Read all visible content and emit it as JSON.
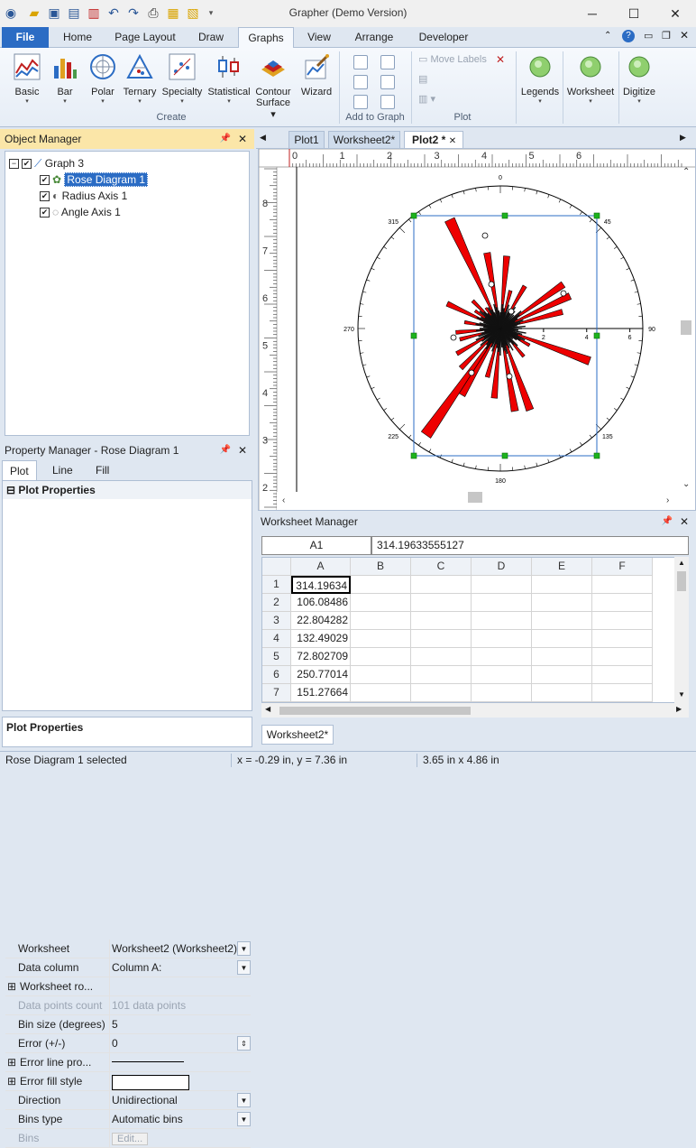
{
  "window": {
    "title": "Grapher (Demo Version)"
  },
  "ribbon_tabs": [
    "File",
    "Home",
    "Page Layout",
    "Draw",
    "Graphs",
    "View",
    "Arrange",
    "Developer"
  ],
  "ribbon": {
    "create": [
      "Basic",
      "Bar",
      "Polar",
      "Ternary",
      "Specialty",
      "Statistical"
    ],
    "contour_1": "Contour",
    "contour_2": "Surface",
    "wizard": "Wizard",
    "move_labels": "Move Labels",
    "legends": "Legends",
    "worksheet": "Worksheet",
    "digitize": "Digitize",
    "groups": {
      "create": "Create",
      "add": "Add to Graph",
      "plot": "Plot"
    }
  },
  "object_manager": {
    "title": "Object Manager",
    "graph": "Graph 3",
    "items": [
      "Rose Diagram 1",
      "Radius Axis 1",
      "Angle Axis 1"
    ]
  },
  "property_manager": {
    "title": "Property Manager - Rose Diagram 1",
    "tabs": [
      "Plot",
      "Line",
      "Fill"
    ],
    "section": "Plot Properties",
    "rows": [
      {
        "k": "Worksheet",
        "v": "Worksheet2 (Worksheet2)"
      },
      {
        "k": "Data column",
        "v": "Column A:"
      },
      {
        "k": "Worksheet ro...",
        "v": ""
      },
      {
        "k": "Data points count",
        "v": "101 data points"
      },
      {
        "k": "Bin size (degrees)",
        "v": "5"
      },
      {
        "k": "Error (+/-)",
        "v": "0"
      },
      {
        "k": "Error line pro...",
        "v": ""
      },
      {
        "k": "Error fill style",
        "v": ""
      },
      {
        "k": "Direction",
        "v": "Unidirectional"
      },
      {
        "k": "Bins type",
        "v": "Automatic bins"
      },
      {
        "k": "Bins",
        "v": "Edit..."
      }
    ],
    "help_title": "Plot Properties"
  },
  "doc_tabs": [
    "Plot1",
    "Worksheet2*",
    "Plot2 *"
  ],
  "plot": {
    "ruler_h": [
      "0",
      "1",
      "2",
      "3",
      "4",
      "5",
      "6"
    ],
    "ruler_v": [
      "8",
      "7",
      "6",
      "5",
      "4",
      "3",
      "2"
    ],
    "angle_labels": {
      "a0": "0",
      "a45": "45",
      "a90": "90",
      "a135": "135",
      "a180": "180",
      "a225": "225",
      "a270": "270",
      "a315": "315"
    },
    "axis_ticks": [
      "2",
      "4",
      "6"
    ]
  },
  "worksheet_manager": {
    "title": "Worksheet Manager",
    "cell_ref": "A1",
    "cell_value": "314.19633555127",
    "columns": [
      "A",
      "B",
      "C",
      "D",
      "E",
      "F"
    ],
    "rows": [
      [
        "1",
        "314.19634"
      ],
      [
        "2",
        "106.08486"
      ],
      [
        "3",
        "22.804282"
      ],
      [
        "4",
        "132.49029"
      ],
      [
        "5",
        "72.802709"
      ],
      [
        "6",
        "250.77014"
      ],
      [
        "7",
        "151.27664"
      ]
    ],
    "sheet_tab": "Worksheet2*"
  },
  "status": {
    "left": "Rose Diagram 1 selected",
    "mid": "x = -0.29 in, y = 7.36 in",
    "right": "3.65 in x 4.86 in"
  },
  "rose_petals": [
    {
      "angle": 335,
      "length": 0.86
    },
    {
      "angle": 315,
      "length": 0.28
    },
    {
      "angle": 350,
      "length": 0.55
    },
    {
      "angle": 5,
      "length": 0.52
    },
    {
      "angle": 15,
      "length": 0.28
    },
    {
      "angle": 30,
      "length": 0.35
    },
    {
      "angle": 55,
      "length": 0.55
    },
    {
      "angle": 65,
      "length": 0.55
    },
    {
      "angle": 75,
      "length": 0.46
    },
    {
      "angle": 110,
      "length": 0.68
    },
    {
      "angle": 120,
      "length": 0.24
    },
    {
      "angle": 140,
      "length": 0.26
    },
    {
      "angle": 160,
      "length": 0.62
    },
    {
      "angle": 170,
      "length": 0.6
    },
    {
      "angle": 185,
      "length": 0.5
    },
    {
      "angle": 195,
      "length": 0.36
    },
    {
      "angle": 210,
      "length": 0.55
    },
    {
      "angle": 215,
      "length": 0.93
    },
    {
      "angle": 225,
      "length": 0.4
    },
    {
      "angle": 240,
      "length": 0.36
    },
    {
      "angle": 255,
      "length": 0.3
    },
    {
      "angle": 265,
      "length": 0.32
    },
    {
      "angle": 280,
      "length": 0.26
    },
    {
      "angle": 295,
      "length": 0.42
    },
    {
      "angle": 305,
      "length": 0.22
    },
    {
      "angle": 325,
      "length": 0.18
    }
  ]
}
